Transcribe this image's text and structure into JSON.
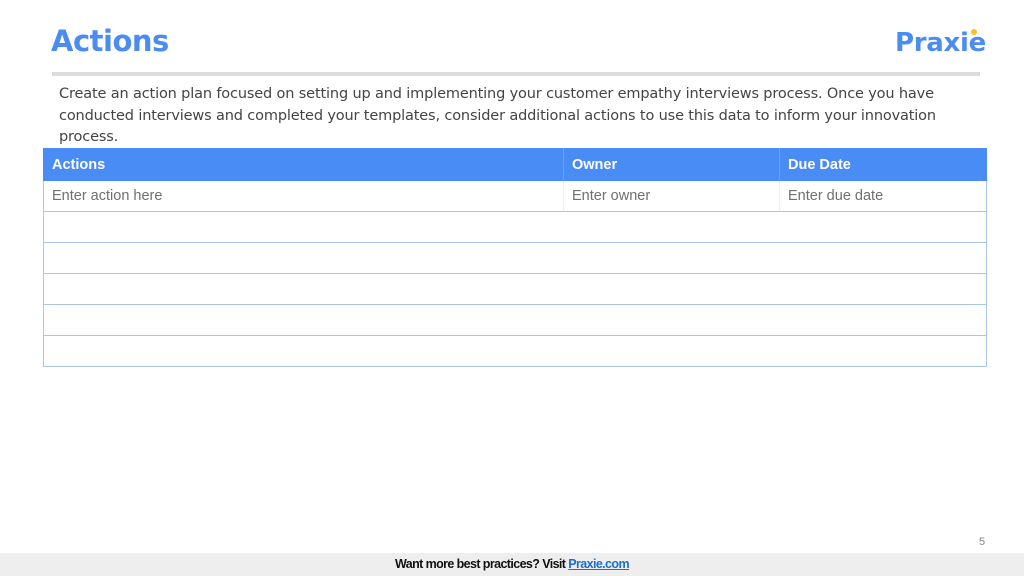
{
  "header": {
    "title": "Actions",
    "logo_text": "Praxie"
  },
  "description": "Create an action plan focused on setting up and implementing your customer empathy interviews process. Once you have conducted interviews and completed your templates, consider additional actions to use this data to inform your innovation process.",
  "table": {
    "columns": [
      "Actions",
      "Owner",
      "Due Date"
    ],
    "rows": [
      [
        "Enter action here",
        "Enter owner",
        "Enter due date"
      ],
      [
        "",
        "",
        ""
      ],
      [
        "",
        "",
        ""
      ],
      [
        "",
        "",
        ""
      ],
      [
        "",
        "",
        ""
      ],
      [
        "",
        "",
        ""
      ]
    ]
  },
  "page_number": "5",
  "footer": {
    "text": "Want more best practices? Visit ",
    "link_text": "Praxie.com"
  },
  "colors": {
    "accent": "#4a8cf0",
    "header_bg": "#4a8cf5",
    "logo_dot": "#f5c518"
  }
}
